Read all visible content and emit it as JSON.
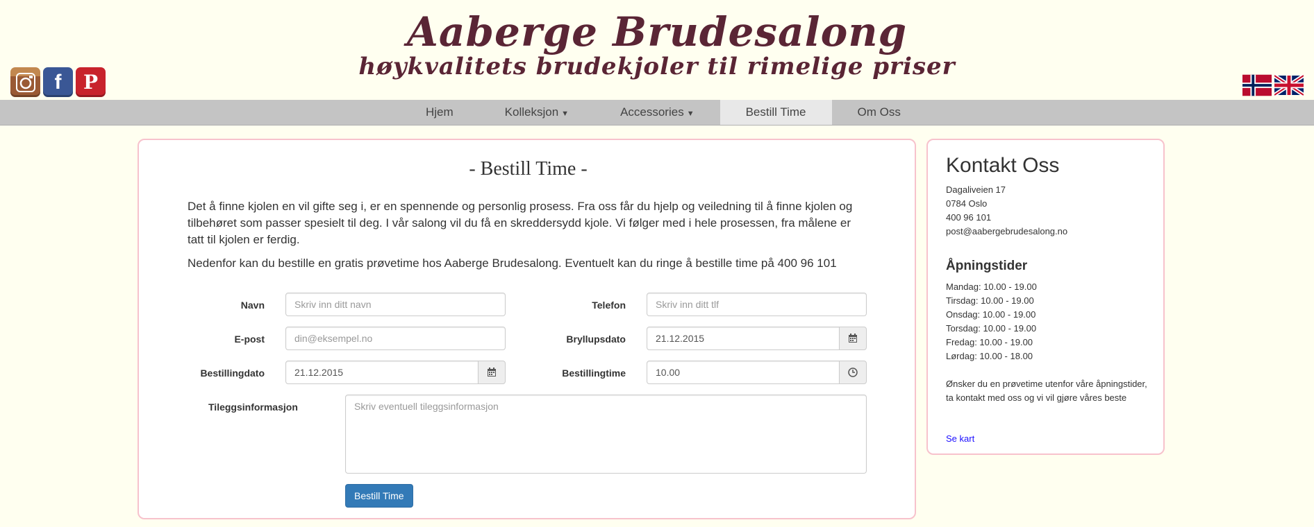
{
  "header": {
    "title": "Aaberge Brudesalong",
    "tagline": "høykvalitets brudekjoler til rimelige priser",
    "social": [
      {
        "name": "instagram",
        "glyph": ""
      },
      {
        "name": "facebook",
        "glyph": "f"
      },
      {
        "name": "pinterest",
        "glyph": "P"
      }
    ],
    "languages": [
      "no",
      "en"
    ]
  },
  "nav": {
    "items": [
      {
        "label": "Hjem",
        "caret": ""
      },
      {
        "label": "Kolleksjon",
        "caret": "▼"
      },
      {
        "label": "Accessories",
        "caret": "▼"
      },
      {
        "label": "Bestill Time",
        "caret": ""
      },
      {
        "label": "Om Oss",
        "caret": ""
      }
    ],
    "active": "Bestill Time"
  },
  "form": {
    "title": "- Bestill Time -",
    "intro1": "Det å finne kjolen en vil gifte seg i, er en spennende og personlig prosess. Fra oss får du hjelp og veiledning til å finne kjolen og tilbehøret som passer spesielt til deg. I vår salong vil du få en skreddersydd kjole. Vi følger med i hele prosessen, fra målene er tatt til kjolen er ferdig.",
    "intro2": "Nedenfor kan du bestille en gratis prøvetime hos Aaberge Brudesalong. Eventuelt kan du ringe å bestille time på 400 96 101",
    "name_label": "Navn",
    "name_placeholder": "Skriv inn ditt navn",
    "phone_label": "Telefon",
    "phone_placeholder": "Skriv inn ditt tlf",
    "email_label": "E-post",
    "email_placeholder": "din@eksempel.no",
    "wedding_label": "Bryllupsdato",
    "wedding_value": "21.12.2015",
    "order_date_label": "Bestillingdato",
    "order_date_value": "21.12.2015",
    "order_time_label": "Bestillingtime",
    "order_time_value": "10.00",
    "info_label": "Tileggsinformasjon",
    "info_placeholder": "Skriv eventuell tileggsinformasjon",
    "submit_label": "Bestill Time"
  },
  "contact": {
    "title": "Kontakt Oss",
    "address": "Dagaliveien 17",
    "postal": "0784 Oslo",
    "phone": "400 96 101",
    "email": "post@aabergebrudesalong.no",
    "hours_title": "Åpningstider",
    "hours": [
      "Mandag: 10.00 - 19.00",
      "Tirsdag: 10.00 - 19.00",
      "Onsdag: 10.00 - 19.00",
      "Torsdag: 10.00 - 19.00",
      "Fredag: 10.00 - 19.00",
      "Lørdag: 10.00 - 18.00"
    ],
    "note": "Ønsker du en prøvetime utenfor våre åpningstider, ta kontakt med oss og vi vil gjøre våres beste",
    "map_link": "Se kart"
  }
}
